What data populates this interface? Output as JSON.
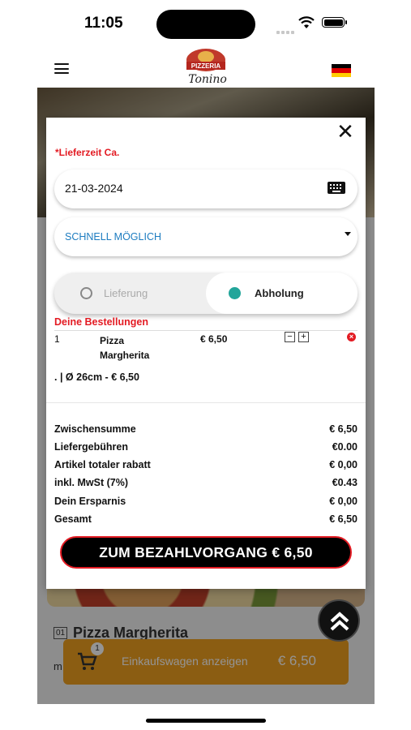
{
  "status_bar": {
    "time": "11:05"
  },
  "header": {
    "logo_top": "PIZZERIA",
    "logo_bottom": "Tonino"
  },
  "background": {
    "dish_number": "01",
    "dish_title": "Pizza Margherita",
    "dish_desc_initial": "m",
    "cart_count": "1",
    "cart_label": "Einkaufswagen anzeigen",
    "cart_price": "€ 6,50"
  },
  "modal": {
    "delivery_time_label": "*Lieferzeit Ca.",
    "date_value": "21-03-2024",
    "time_select_value": "SCHNELL MÖGLICH",
    "delivery_option": "Lieferung",
    "pickup_option": "Abholung",
    "selected_option": "Abholung",
    "orders_title": "Deine Bestellungen",
    "order": {
      "qty": "1",
      "name": "Pizza Margherita",
      "price": "€ 6,50",
      "minus": "−",
      "plus": "+",
      "remove": "×",
      "option": ". | Ø 26cm - € 6,50"
    },
    "summary": [
      {
        "label": "Zwischensumme",
        "value": "€ 6,50"
      },
      {
        "label": "Liefergebühren",
        "value": "€0.00"
      },
      {
        "label": "Artikel totaler rabatt",
        "value": "€ 0,00"
      },
      {
        "label": "inkl. MwSt (7%)",
        "value": "€0.43"
      },
      {
        "label": "Dein Ersparnis",
        "value": "€ 0,00"
      },
      {
        "label": "Gesamt",
        "value": "€ 6,50"
      }
    ],
    "checkout_label": "ZUM BEZAHLVORGANG € 6,50",
    "close": "✕"
  },
  "colors": {
    "accent_red": "#e31b23",
    "link_blue": "#1d7cc0",
    "teal": "#22a59a",
    "cart_orange": "#f0a020"
  },
  "icons": [
    "menu-icon",
    "flag-de-icon",
    "wifi-icon",
    "battery-icon",
    "keyboard-icon",
    "close-icon",
    "cart-icon",
    "chevrons-up-icon",
    "remove-icon"
  ]
}
